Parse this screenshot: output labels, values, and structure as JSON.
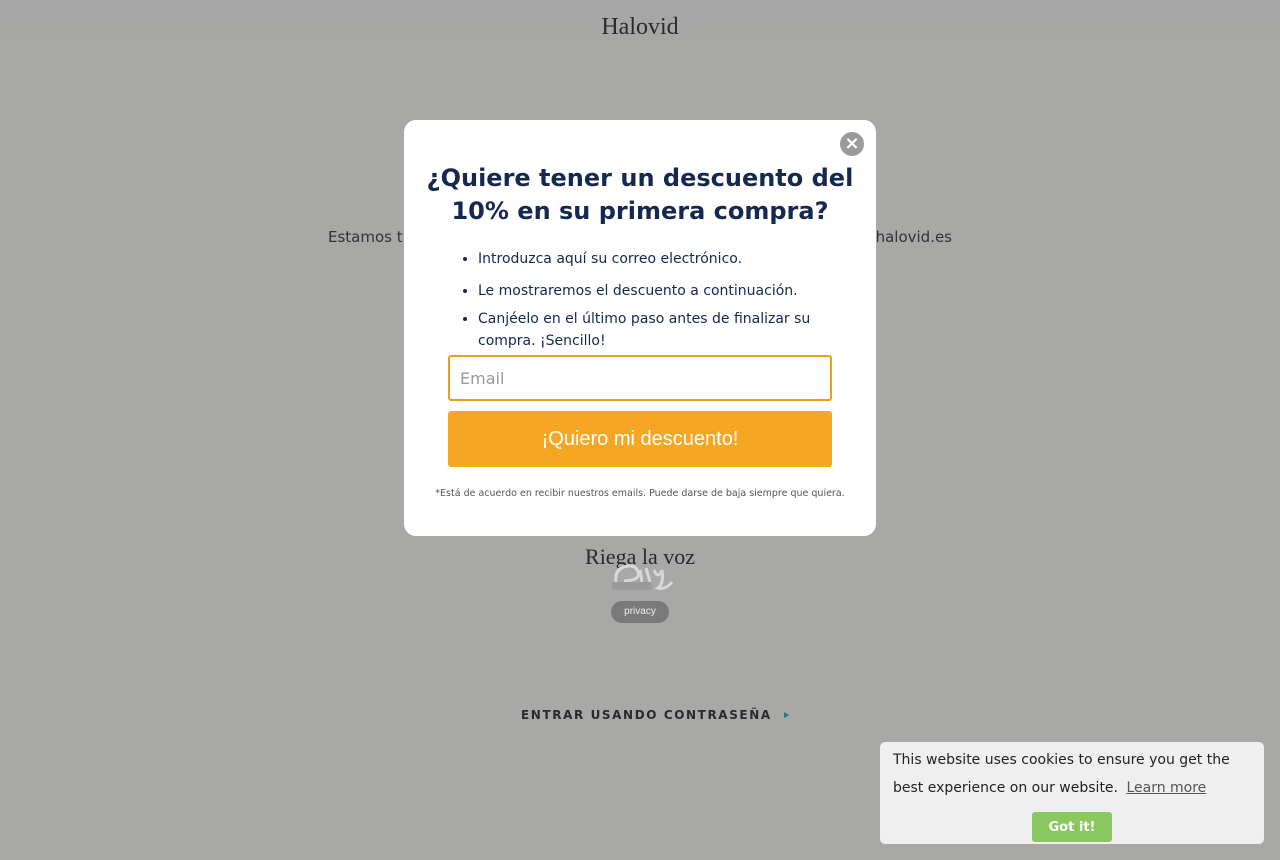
{
  "site": {
    "title": "Halovid",
    "message_left": "Estamos tr",
    "message_right": "@halovid.es",
    "share_heading": "Riega la voz",
    "privacy_label": "privacy",
    "password_link": "ENTRAR USANDO CONTRASEÑA"
  },
  "modal": {
    "close_label": "×",
    "title": "¿Quiere tener un descuento del 10% en su primera compra?",
    "steps": [
      "Introduzca aquí su correo electrónico.",
      "Le mostraremos el descuento a continuación.",
      "Canjéelo en el último paso antes de finalizar su compra. ¡Sencillo!"
    ],
    "email_placeholder": "Email",
    "email_value": "",
    "cta_label": "¡Quiero mi descuento!",
    "disclaimer": "*Está de acuerdo en recibir nuestros emails. Puede darse de baja siempre que quiera."
  },
  "cookie": {
    "text": "This website uses cookies to ensure you get the best experience on our website.",
    "learn_more": "Learn more",
    "accept_label": "Got it!"
  },
  "colors": {
    "overlay": "#a8a8a6",
    "title_text": "#142850",
    "accent": "#f5a623",
    "cookie_button": "#8cc860"
  }
}
